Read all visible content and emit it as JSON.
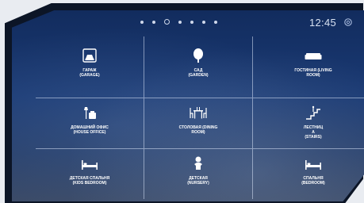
{
  "header": {
    "pager": {
      "count": 7,
      "active_index": 2
    },
    "clock": "12:45",
    "settings_icon": "gear-icon"
  },
  "rooms": [
    {
      "label": "ГАРАЖ\n(GARAGE)",
      "icon": "garage-icon"
    },
    {
      "label": "САД\n(GARDEN)",
      "icon": "tree-icon"
    },
    {
      "label": "ГОСТИНАЯ (LIVING\nROOM)",
      "icon": "sofa-icon"
    },
    {
      "label": "ДОМАШНИЙ ОФИС\n(HOUSE OFFICE)",
      "icon": "desk-lamp-icon"
    },
    {
      "label": "СТОЛОВАЯ (DINING\nROOM)",
      "icon": "dining-table-icon"
    },
    {
      "label": "ЛЕСТНИЦ\nА\n(STAIRS)",
      "icon": "stairs-icon"
    },
    {
      "label": "ДЕТСКАЯ СПАЛЬНЯ\n(KIDS BEDROOM)",
      "icon": "bed-icon"
    },
    {
      "label": "ДЕТСКАЯ\n(NURSERY)",
      "icon": "baby-icon"
    },
    {
      "label": "СПАЛЬНЯ\n(BEDROOM)",
      "icon": "bed-icon"
    }
  ],
  "colors": {
    "panel": "#1a3a74",
    "bezel": "#0c1526",
    "grid_line": "#d7e1f5"
  }
}
